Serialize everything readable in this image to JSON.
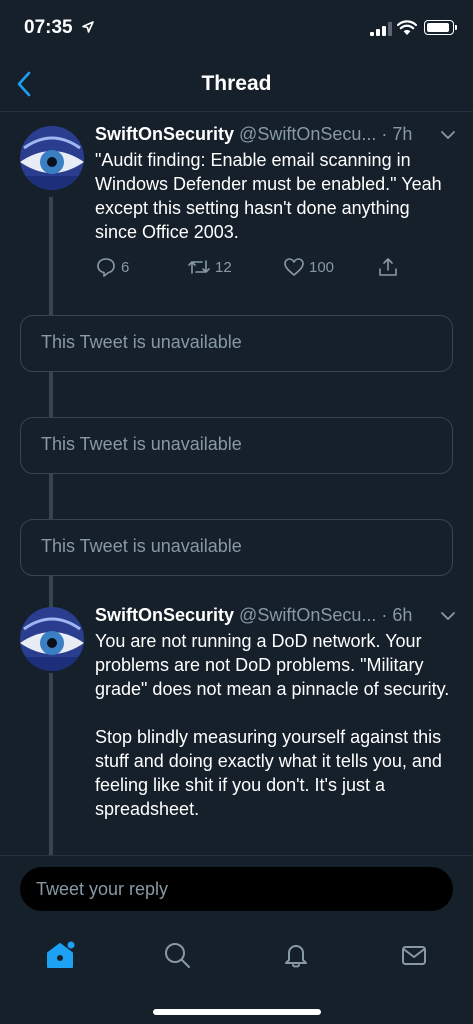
{
  "status_bar": {
    "time": "07:35"
  },
  "nav": {
    "title": "Thread"
  },
  "tweets": [
    {
      "name": "SwiftOnSecurity",
      "handle": "@SwiftOnSecu...",
      "time": "· 7h",
      "text": "\"Audit finding: Enable email scanning in Windows Defender must be enabled.\" Yeah except this setting hasn't done anything since Office 2003.",
      "replies": "6",
      "retweets": "12",
      "likes": "100"
    },
    {
      "name": "SwiftOnSecurity",
      "handle": "@SwiftOnSecu...",
      "time": "· 6h",
      "text": "You are not running a DoD network. Your problems are not DoD problems. \"Military grade\" does not mean a pinnacle of security.\n\nStop blindly measuring yourself against this stuff and doing exactly what it tells you, and feeling like shit if you don't. It's just a spreadsheet."
    }
  ],
  "unavailable": [
    "This Tweet is unavailable",
    "This Tweet is unavailable",
    "This Tweet is unavailable"
  ],
  "reply": {
    "placeholder": "Tweet your reply"
  },
  "colors": {
    "background": "#15202b",
    "accent": "#1da1f2",
    "muted": "#8899a6",
    "border": "#38444d"
  }
}
